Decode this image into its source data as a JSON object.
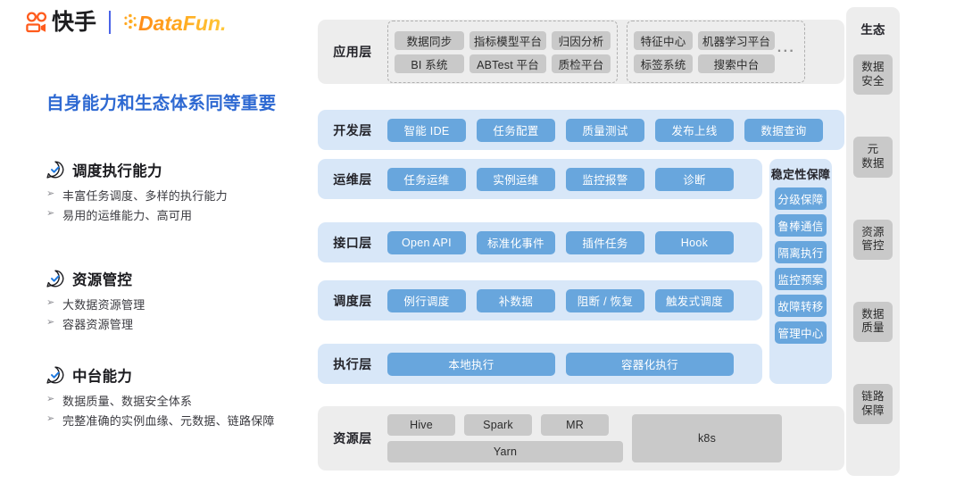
{
  "brand": {
    "kuaishou_name": "快手",
    "kuaishou_icon": "kuaishou-logo-icon",
    "divider": "|",
    "datafun_name": "DataFun.",
    "datafun_icon": "datafun-logo-icon"
  },
  "headline": "自身能力和生态体系同等重要",
  "features": [
    {
      "icon": "check-circle-icon",
      "title": "调度执行能力",
      "bullets": [
        "丰富任务调度、多样的执行能力",
        "易用的运维能力、高可用"
      ]
    },
    {
      "icon": "check-circle-icon",
      "title": "资源管控",
      "bullets": [
        "大数据资源管理",
        "容器资源管理"
      ]
    },
    {
      "icon": "check-circle-icon",
      "title": "中台能力",
      "bullets": [
        "数据质量、数据安全体系",
        "完整准确的实例血缘、元数据、链路保障"
      ]
    }
  ],
  "bullet_marker": "➢",
  "diagram": {
    "layers": [
      {
        "id": "app",
        "label": "应用层",
        "style": "grey",
        "groups": [
          {
            "rows": [
              [
                "数据同步",
                "指标模型平台",
                "归因分析"
              ],
              [
                "BI 系统",
                "ABTest 平台",
                "质检平台"
              ]
            ]
          },
          {
            "rows": [
              [
                "特征中心",
                "机器学习平台"
              ],
              [
                "标签系统",
                "搜索中台"
              ]
            ],
            "trailing": "···"
          }
        ]
      },
      {
        "id": "dev",
        "label": "开发层",
        "style": "blue",
        "chips": [
          "智能 IDE",
          "任务配置",
          "质量测试",
          "发布上线",
          "数据查询"
        ]
      },
      {
        "id": "ops",
        "label": "运维层",
        "style": "blue",
        "chips": [
          "任务运维",
          "实例运维",
          "监控报警",
          "诊断"
        ]
      },
      {
        "id": "api",
        "label": "接口层",
        "style": "blue",
        "chips": [
          "Open API",
          "标准化事件",
          "插件任务",
          "Hook"
        ]
      },
      {
        "id": "schedule",
        "label": "调度层",
        "style": "blue",
        "chips": [
          "例行调度",
          "补数据",
          "阻断 / 恢复",
          "触发式调度"
        ]
      },
      {
        "id": "exec",
        "label": "执行层",
        "style": "blue",
        "chips": [
          "本地执行",
          "容器化执行"
        ]
      },
      {
        "id": "resource",
        "label": "资源层",
        "style": "grey",
        "chips_top": [
          "Hive",
          "Spark",
          "MR"
        ],
        "chips_bottom": [
          "Yarn"
        ],
        "chip_tall": "k8s"
      }
    ],
    "stability": {
      "title": "稳定性保障",
      "chips": [
        "分级保障",
        "鲁棒通信",
        "隔离执行",
        "监控预案",
        "故障转移",
        "管理中心"
      ]
    },
    "eco": {
      "title": "生态",
      "chips": [
        "数据\n安全",
        "元\n数据",
        "资源\n管控",
        "数据\n质量",
        "链路\n保障"
      ]
    }
  },
  "colors": {
    "headline_blue": "#2e69d2",
    "chip_blue": "#68a6dd",
    "band_blue": "#d8e7f8",
    "chip_grey": "#c9c9c9",
    "band_grey": "#ededed",
    "brand_orange": "#ff6a21",
    "datafun_orange": "#f5a623"
  }
}
